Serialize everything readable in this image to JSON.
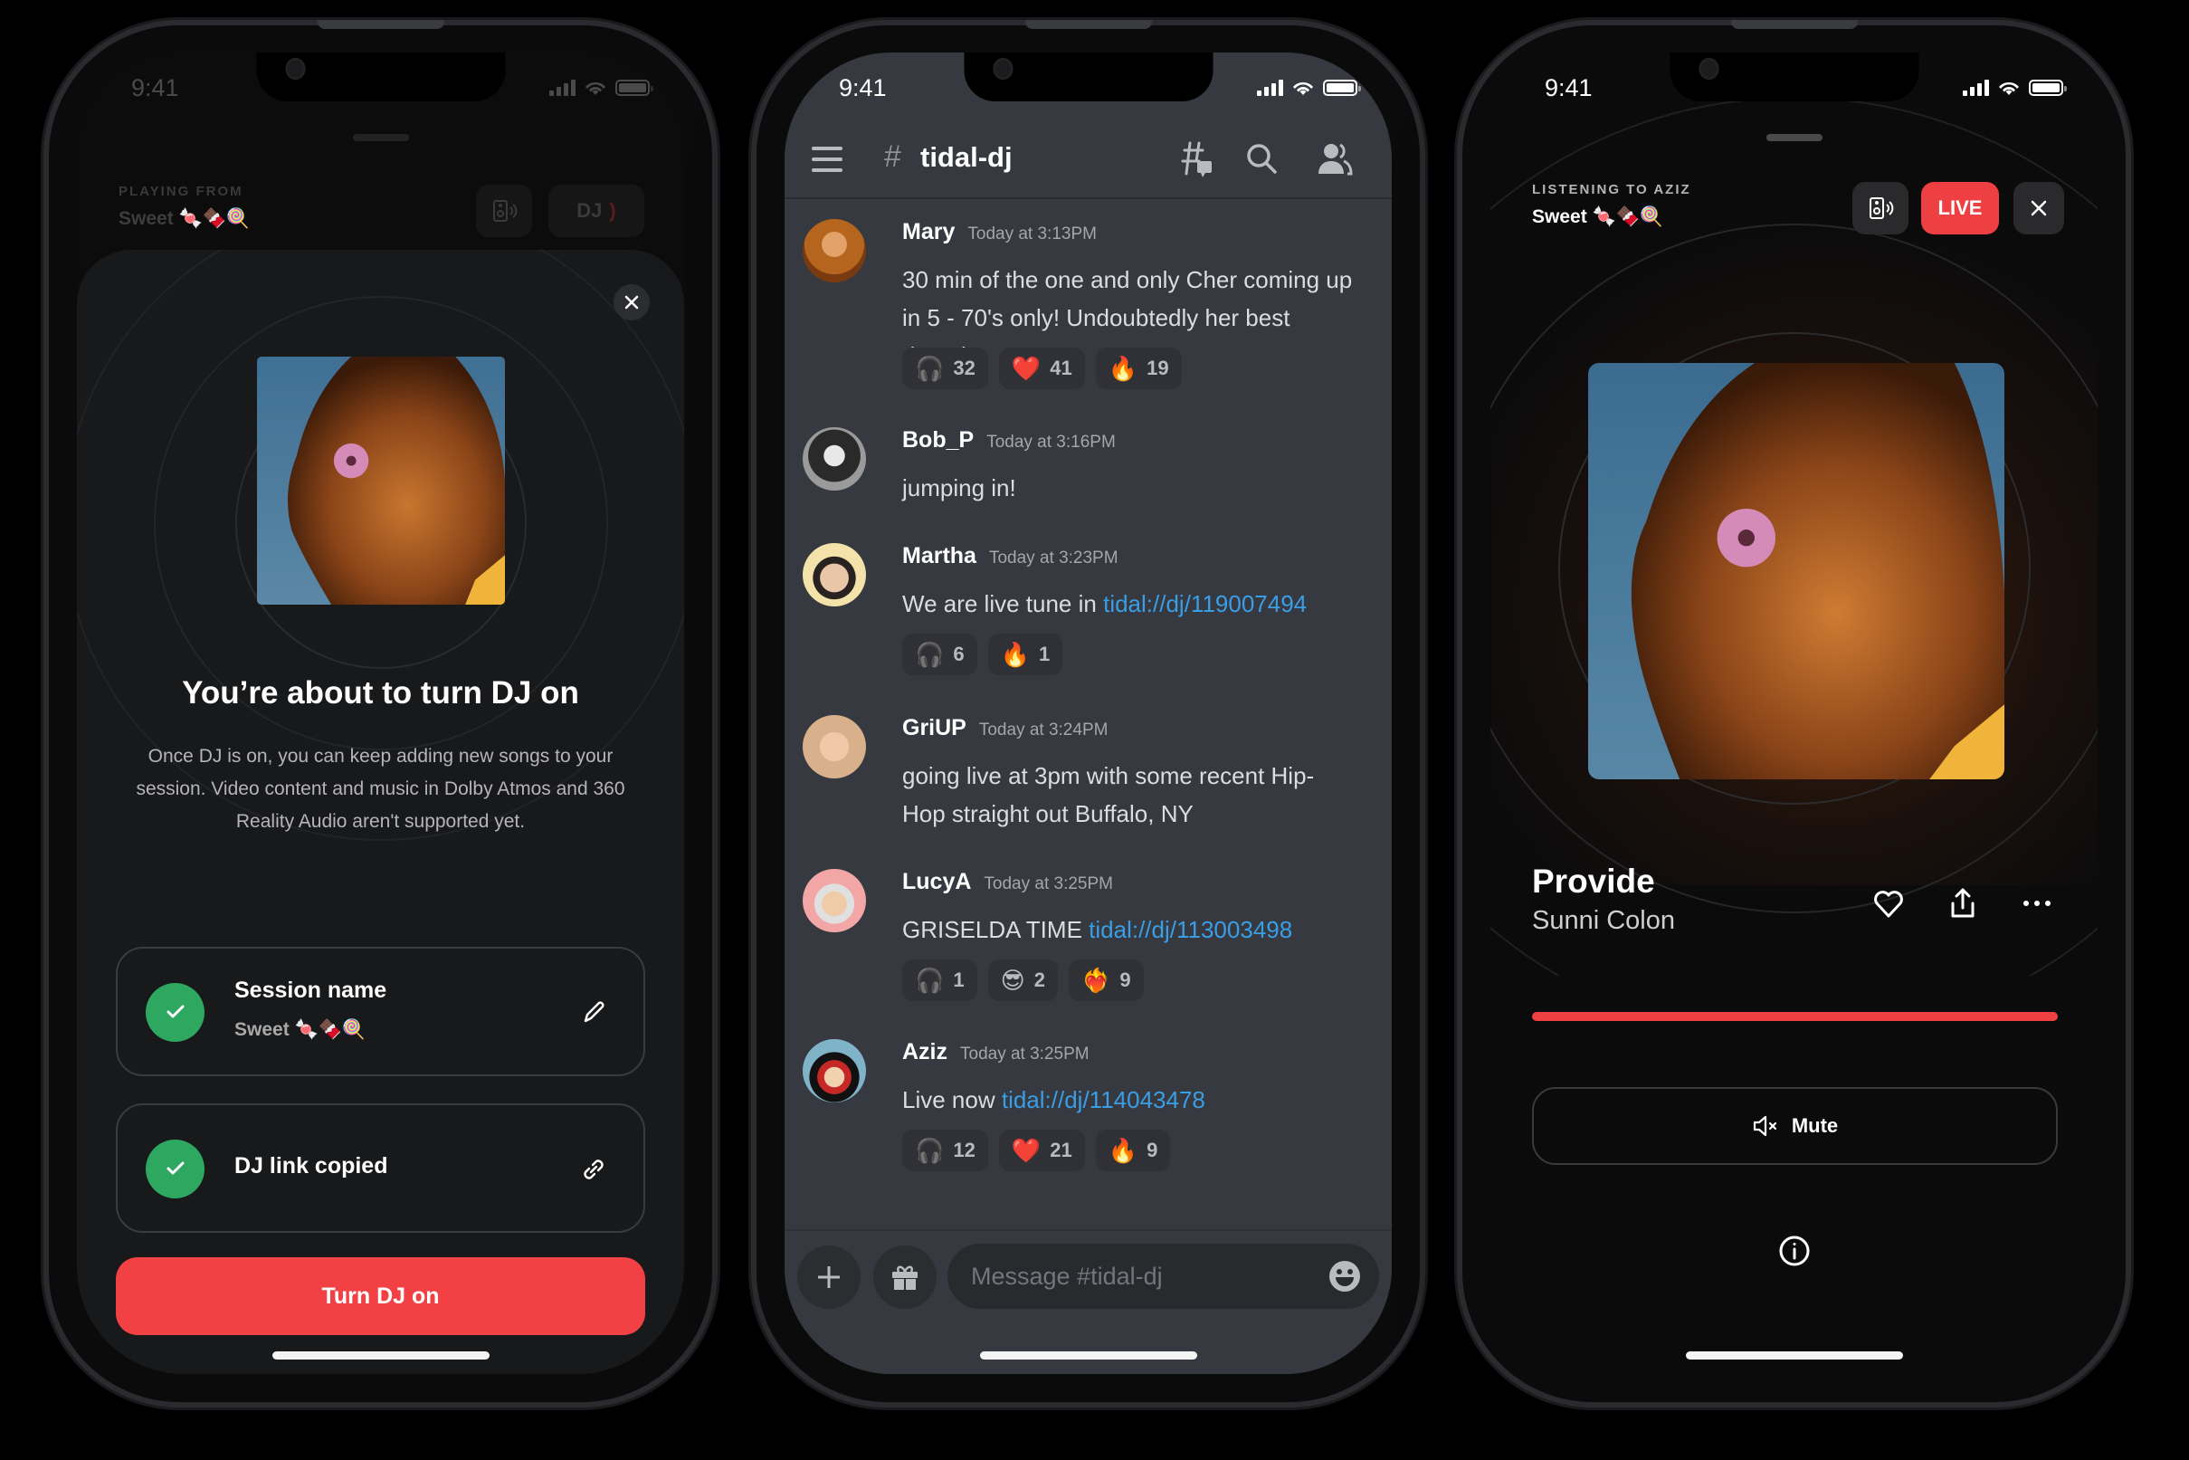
{
  "status_bar": {
    "time": "9:41"
  },
  "dj_setup": {
    "playing_from_label": "PLAYING FROM",
    "playlist_name": "Sweet 🍬🍫🍭",
    "dj_button_label": "DJ",
    "modal": {
      "title": "You’re about to turn DJ on",
      "description": "Once DJ is on, you can keep adding new songs to your session. Video content and music in Dolby Atmos and 360 Reality Audio aren't supported yet.",
      "cards": [
        {
          "title": "Session name",
          "subtitle": "Sweet 🍬🍫🍭",
          "status": "done",
          "action_icon": "pencil-icon"
        },
        {
          "title": "DJ link copied",
          "subtitle": "",
          "status": "done",
          "action_icon": "link-icon"
        }
      ],
      "cta_label": "Turn DJ on"
    }
  },
  "chat": {
    "channel": "tidal-dj",
    "messages": [
      {
        "author": "Mary",
        "timestamp": "Today at 3:13PM",
        "text": "30 min of the one and only Cher coming up in 5 - 70's only! Undoubtedly her best decade",
        "link": "",
        "avatar_color": "#b5651d",
        "reactions": [
          {
            "emoji": "🎧",
            "count": "32"
          },
          {
            "emoji": "❤️",
            "count": "41"
          },
          {
            "emoji": "🔥",
            "count": "19"
          }
        ]
      },
      {
        "author": "Bob_P",
        "timestamp": "Today at 3:16PM",
        "text": "jumping in!",
        "link": "",
        "avatar_color": "#777777",
        "reactions": []
      },
      {
        "author": "Martha",
        "timestamp": "Today at 3:23PM",
        "text": "We are live tune in",
        "link": "tidal://dj/119007494",
        "avatar_color": "#f3e2a9",
        "reactions": [
          {
            "emoji": "🎧",
            "count": "6"
          },
          {
            "emoji": "🔥",
            "count": "1"
          }
        ]
      },
      {
        "author": "GriUP",
        "timestamp": "Today at 3:24PM",
        "text": "going live at 3pm with some recent Hip-Hop straight out Buffalo, NY",
        "link": "",
        "avatar_color": "#d9b08c",
        "reactions": []
      },
      {
        "author": "LucyA",
        "timestamp": "Today at 3:25PM",
        "text": "GRISELDA TIME",
        "link": "tidal://dj/113003498",
        "avatar_color": "#f2a6a6",
        "reactions": [
          {
            "emoji": "🎧",
            "count": "1"
          },
          {
            "emoji": "😎",
            "count": "2"
          },
          {
            "emoji": "❤️‍🔥",
            "count": "9"
          }
        ]
      },
      {
        "author": "Aziz",
        "timestamp": "Today at 3:25PM",
        "text": "Live now ",
        "link": "tidal://dj/114043478",
        "avatar_color": "#7fb3c8",
        "reactions": [
          {
            "emoji": "🎧",
            "count": "12"
          },
          {
            "emoji": "❤️",
            "count": "21"
          },
          {
            "emoji": "🔥",
            "count": "9"
          }
        ]
      }
    ],
    "composer_placeholder": "Message #tidal-dj"
  },
  "now_playing": {
    "listening_label": "LISTENING TO AZIZ",
    "playlist_name": "Sweet 🍬🍫🍭",
    "live_label": "LIVE",
    "track_title": "Provide",
    "artist": "Sunni Colon",
    "progress": 1.0,
    "mute_label": "Mute",
    "accent_color": "#ee3f43"
  }
}
